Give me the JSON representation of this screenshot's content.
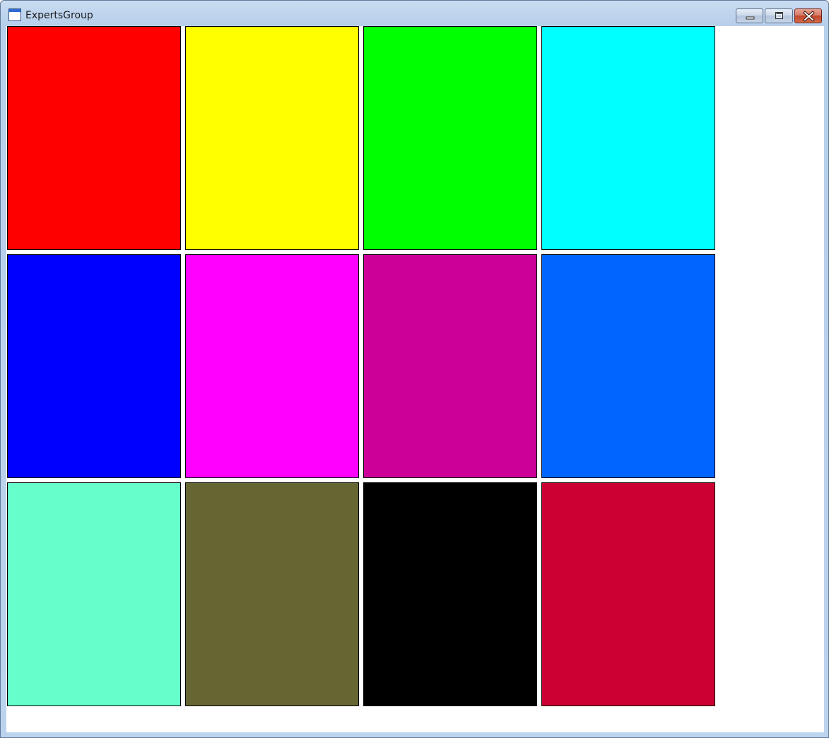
{
  "window": {
    "title": "ExpertsGroup"
  },
  "swatches": [
    {
      "color": "#ff0000"
    },
    {
      "color": "#ffff00"
    },
    {
      "color": "#00ff00"
    },
    {
      "color": "#00ffff"
    },
    {
      "color": "#0000ff"
    },
    {
      "color": "#ff00ff"
    },
    {
      "color": "#cc0099"
    },
    {
      "color": "#0066ff"
    },
    {
      "color": "#66ffcc"
    },
    {
      "color": "#666633"
    },
    {
      "color": "#000000"
    },
    {
      "color": "#cc0033"
    }
  ],
  "icons": {
    "app": "window-icon",
    "minimize": "minimize-icon",
    "maximize": "maximize-icon",
    "close": "close-icon"
  }
}
